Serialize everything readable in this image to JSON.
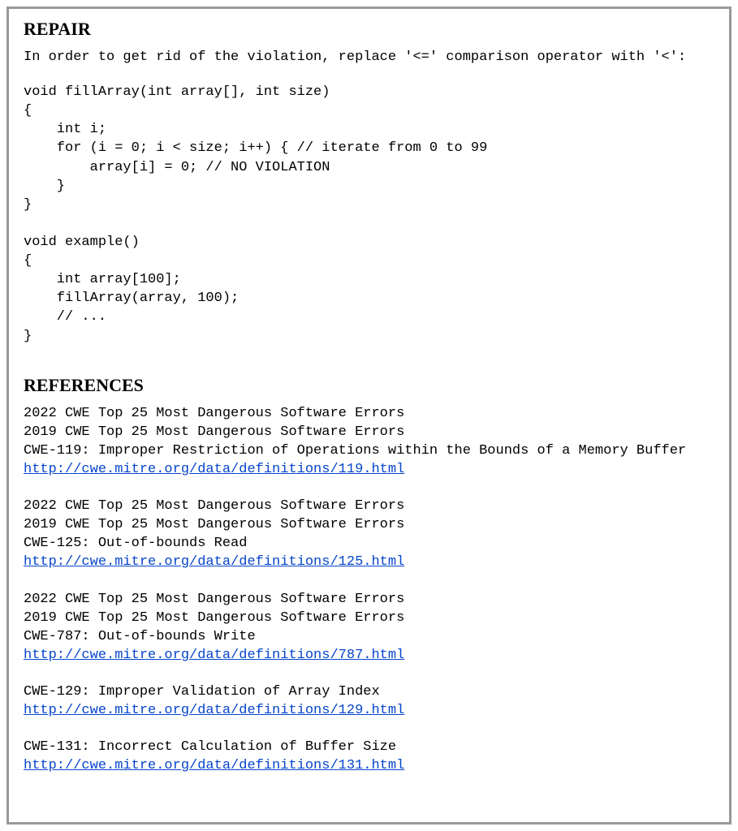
{
  "repair": {
    "heading": "REPAIR",
    "intro": "In order to get rid of the violation, replace '<=' comparison operator with '<':",
    "code": "void fillArray(int array[], int size)\n{\n    int i;\n    for (i = 0; i < size; i++) { // iterate from 0 to 99\n        array[i] = 0; // NO VIOLATION\n    }\n}\n\nvoid example()\n{\n    int array[100];\n    fillArray(array, 100);\n    // ...\n}"
  },
  "references": {
    "heading": "REFERENCES",
    "items": [
      {
        "lines": [
          "2022 CWE Top 25 Most Dangerous Software Errors",
          "2019 CWE Top 25 Most Dangerous Software Errors",
          "CWE-119: Improper Restriction of Operations within the Bounds of a Memory Buffer"
        ],
        "link": "http://cwe.mitre.org/data/definitions/119.html"
      },
      {
        "lines": [
          "2022 CWE Top 25 Most Dangerous Software Errors",
          "2019 CWE Top 25 Most Dangerous Software Errors",
          "CWE-125: Out-of-bounds Read"
        ],
        "link": "http://cwe.mitre.org/data/definitions/125.html"
      },
      {
        "lines": [
          "2022 CWE Top 25 Most Dangerous Software Errors",
          "2019 CWE Top 25 Most Dangerous Software Errors",
          "CWE-787: Out-of-bounds Write"
        ],
        "link": "http://cwe.mitre.org/data/definitions/787.html"
      },
      {
        "lines": [
          "CWE-129: Improper Validation of Array Index"
        ],
        "link": "http://cwe.mitre.org/data/definitions/129.html"
      },
      {
        "lines": [
          "CWE-131: Incorrect Calculation of Buffer Size"
        ],
        "link": "http://cwe.mitre.org/data/definitions/131.html"
      }
    ]
  }
}
